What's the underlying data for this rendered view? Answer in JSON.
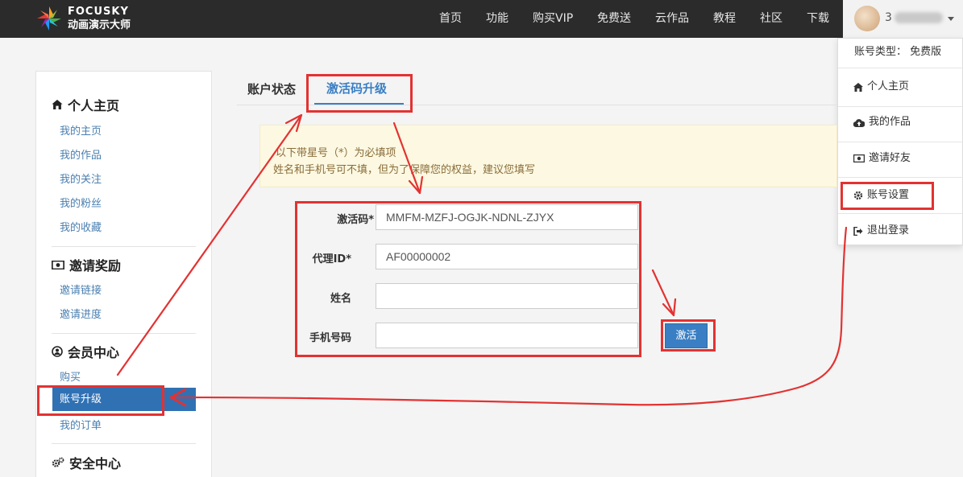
{
  "brand": {
    "name_en": "FOCUSKY",
    "name_cn": "动画演示大师"
  },
  "nav": {
    "items": [
      "首页",
      "功能",
      "购买VIP",
      "免费送",
      "云作品",
      "教程",
      "社区",
      "下载"
    ],
    "username": "3"
  },
  "dropdown": {
    "account_type": "账号类型： 免费版",
    "items": [
      {
        "label": "个人主页",
        "icon": "home-icon"
      },
      {
        "label": "我的作品",
        "icon": "cloud-upload-icon"
      },
      {
        "label": "邀请好友",
        "icon": "money-icon"
      },
      {
        "label": "账号设置",
        "icon": "gear-icon"
      },
      {
        "label": "退出登录",
        "icon": "sign-out-icon"
      }
    ]
  },
  "sidebar": {
    "sections": [
      {
        "title": "个人主页",
        "icon": "home-icon",
        "links": [
          "我的主页",
          "我的作品",
          "我的关注",
          "我的粉丝",
          "我的收藏"
        ]
      },
      {
        "title": "邀请奖励",
        "icon": "money-icon",
        "links": [
          "邀请链接",
          "邀请进度"
        ]
      },
      {
        "title": "会员中心",
        "icon": "user-circle-icon",
        "links": [
          "购买",
          "账号升级",
          "我的订单"
        ],
        "active": "账号升级"
      },
      {
        "title": "安全中心",
        "icon": "gears-icon",
        "links": []
      }
    ]
  },
  "tabs": {
    "account_status": "账户状态",
    "activation_upgrade": "激活码升级",
    "active": "激活码升级"
  },
  "notice": {
    "line1": "以下带星号（*）为必填项",
    "line2": "姓名和手机号可不填，但为了保障您的权益，建议您填写"
  },
  "form": {
    "activation_code_label": "激活码*",
    "activation_code_value": "MMFM-MZFJ-OGJK-NDNL-ZJYX",
    "agent_id_label": "代理ID*",
    "agent_id_value": "AF00000002",
    "name_label": "姓名",
    "name_value": "",
    "phone_label": "手机号码",
    "phone_value": "",
    "submit_label": "激活"
  },
  "colors": {
    "navbar": "#2b2b2b",
    "accent": "#3a7fc4",
    "annotation": "#e33232",
    "notice_bg": "#fcf8e1"
  }
}
